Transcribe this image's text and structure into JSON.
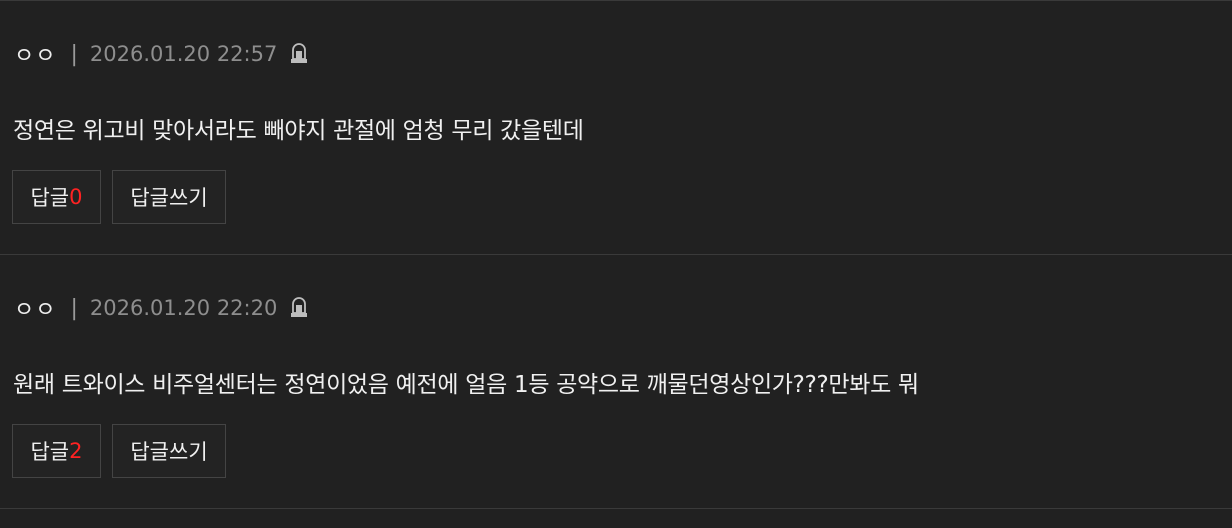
{
  "comments": [
    {
      "author": "ㅇㅇ",
      "separator": "|",
      "date": "2026.01.20 22:57",
      "body": "정연은 위고비 맞아서라도 빼야지 관절에 엄청 무리 갔을텐데",
      "reply_label": "답글",
      "reply_count": "0",
      "write_reply_label": "답글쓰기"
    },
    {
      "author": "ㅇㅇ",
      "separator": "|",
      "date": "2026.01.20 22:20",
      "body": "원래 트와이스 비주얼센터는 정연이었음 예전에 얼음 1등 공약으로 깨물던영상인가???만봐도 뭐",
      "reply_label": "답글",
      "reply_count": "2",
      "write_reply_label": "답글쓰기"
    }
  ],
  "icons": {
    "report": "siren-icon"
  },
  "colors": {
    "background": "#212121",
    "divider": "#3a3a3a",
    "reply_count": "#ff2222",
    "date": "#8e8e8e"
  }
}
